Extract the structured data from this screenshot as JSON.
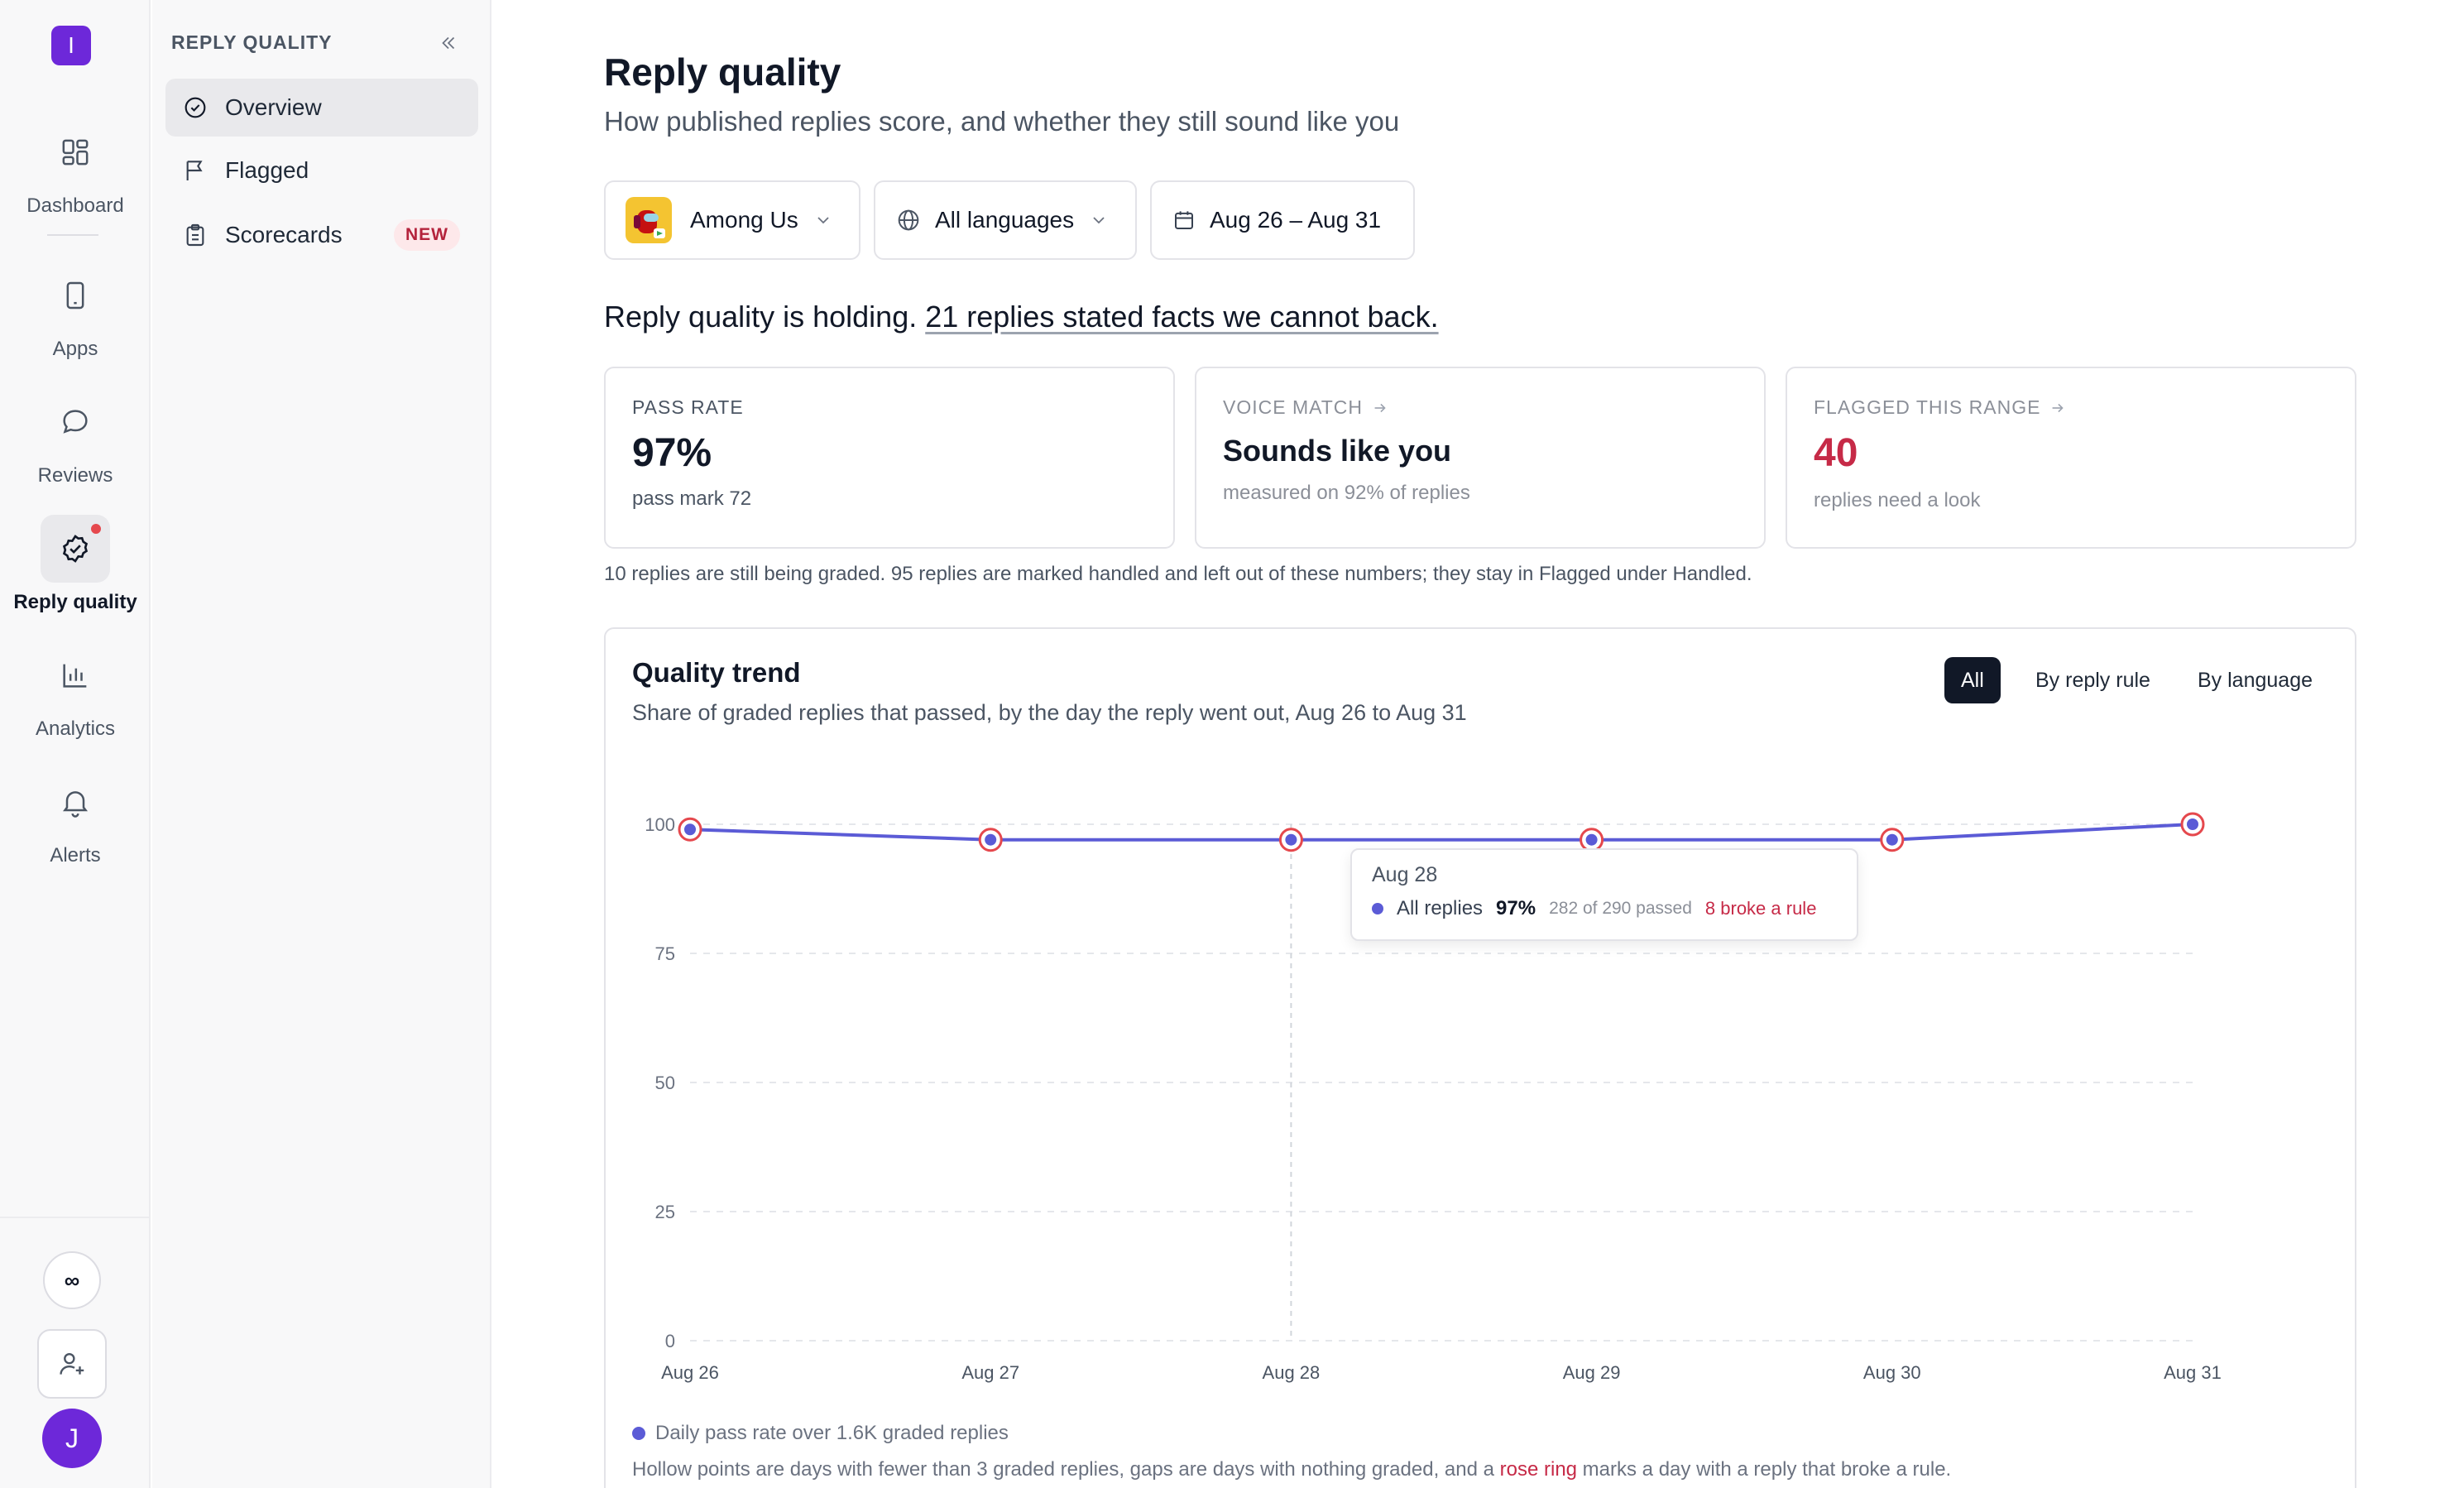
{
  "app": {
    "logo_letter": "I"
  },
  "rail": {
    "items": [
      {
        "label": "Dashboard",
        "icon": "grid-icon"
      },
      {
        "label": "Apps",
        "icon": "phone-icon"
      },
      {
        "label": "Reviews",
        "icon": "chat-bubble-icon"
      },
      {
        "label": "Reply quality",
        "icon": "check-badge-icon",
        "active": true,
        "has_alert_dot": true
      },
      {
        "label": "Analytics",
        "icon": "bar-chart-icon"
      },
      {
        "label": "Alerts",
        "icon": "bell-icon"
      }
    ],
    "bottom": {
      "infinity_label": "∞",
      "avatar_letter": "J"
    }
  },
  "subnav": {
    "title": "REPLY QUALITY",
    "items": [
      {
        "label": "Overview",
        "icon": "check-circle-icon",
        "active": true
      },
      {
        "label": "Flagged",
        "icon": "flag-icon"
      },
      {
        "label": "Scorecards",
        "icon": "clipboard-icon",
        "badge": "NEW"
      }
    ]
  },
  "page": {
    "title": "Reply quality",
    "subtitle": "How published replies score, and whether they still sound like you"
  },
  "filters": {
    "app": "Among Us",
    "language": "All languages",
    "date_range": "Aug 26 – Aug 31"
  },
  "headline": {
    "lead": "Reply quality is holding.",
    "link": "21 replies stated facts we cannot back."
  },
  "cards": {
    "pass_rate": {
      "label": "PASS RATE",
      "value": "97%",
      "sub": "pass mark 72"
    },
    "voice_match": {
      "label": "VOICE MATCH",
      "value": "Sounds like you",
      "sub": "measured on 92% of replies"
    },
    "flagged": {
      "label": "FLAGGED THIS RANGE",
      "value": "40",
      "sub": "replies need a look"
    }
  },
  "note": "10 replies are still being graded. 95 replies are marked handled and left out of these numbers; they stay in Flagged under Handled.",
  "trend": {
    "title": "Quality trend",
    "subtitle": "Share of graded replies that passed, by the day the reply went out, Aug 26 to Aug 31",
    "segments": [
      "All",
      "By reply rule",
      "By language"
    ],
    "active_segment": "All",
    "tooltip": {
      "date": "Aug 28",
      "series": "All replies",
      "pct": "97%",
      "count": "282 of 290 passed",
      "broke": "8 broke a rule"
    },
    "legend": "Daily pass rate over 1.6K graded replies",
    "footnote_pre": "Hollow points are days with fewer than 3 graded replies, gaps are days with nothing graded, and a ",
    "footnote_link": "rose ring",
    "footnote_post": " marks a day with a reply that broke a rule."
  },
  "chart_data": {
    "type": "line",
    "categories": [
      "Aug 26",
      "Aug 27",
      "Aug 28",
      "Aug 29",
      "Aug 30",
      "Aug 31"
    ],
    "series": [
      {
        "name": "All replies",
        "values": [
          99,
          97,
          97,
          97,
          97,
          100
        ],
        "broke_rule": [
          true,
          true,
          true,
          true,
          true,
          true
        ]
      }
    ],
    "ylim": [
      0,
      100
    ],
    "yticks": [
      0,
      25,
      50,
      75,
      100
    ],
    "grid": true,
    "highlight_index": 2,
    "colors": {
      "line": "#5b5bd6",
      "ring": "#e5484d",
      "grid": "#e5e7eb"
    }
  },
  "colors": {
    "accent": "#6d28d9",
    "danger": "#c62a47",
    "dark": "#111827"
  }
}
